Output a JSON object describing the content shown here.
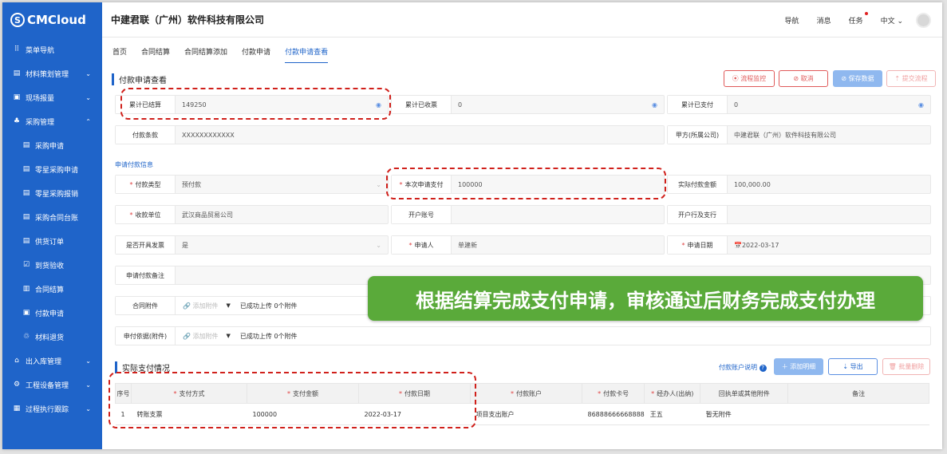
{
  "brand": {
    "logo_text": "CMCloud",
    "logo_mark": "S"
  },
  "sidebar": {
    "items": [
      {
        "label": "菜单导航",
        "icon": "grid-icon",
        "glyph": "⠿",
        "sub": false,
        "chevron": ""
      },
      {
        "label": "材料策划管理",
        "icon": "clipboard-icon",
        "glyph": "▤",
        "sub": false,
        "chevron": "⌄"
      },
      {
        "label": "现场报量",
        "icon": "report-icon",
        "glyph": "▣",
        "sub": false,
        "chevron": "⌄"
      },
      {
        "label": "采购管理",
        "icon": "org-icon",
        "glyph": "♣",
        "sub": false,
        "chevron": "⌃"
      },
      {
        "label": "采购申请",
        "icon": "form-icon",
        "glyph": "▤",
        "sub": true,
        "chevron": ""
      },
      {
        "label": "零星采购申请",
        "icon": "form-icon",
        "glyph": "▤",
        "sub": true,
        "chevron": ""
      },
      {
        "label": "零星采购报销",
        "icon": "form-icon",
        "glyph": "▤",
        "sub": true,
        "chevron": ""
      },
      {
        "label": "采购合同台账",
        "icon": "form-icon",
        "glyph": "▤",
        "sub": true,
        "chevron": ""
      },
      {
        "label": "供货订单",
        "icon": "list-icon",
        "glyph": "▤",
        "sub": true,
        "chevron": ""
      },
      {
        "label": "到货验收",
        "icon": "check-icon",
        "glyph": "☑",
        "sub": true,
        "chevron": ""
      },
      {
        "label": "合同结算",
        "icon": "doc-icon",
        "glyph": "▥",
        "sub": true,
        "chevron": ""
      },
      {
        "label": "付款申请",
        "icon": "pay-icon",
        "glyph": "▣",
        "sub": true,
        "chevron": ""
      },
      {
        "label": "材料退货",
        "icon": "return-icon",
        "glyph": "♲",
        "sub": true,
        "chevron": ""
      },
      {
        "label": "出入库管理",
        "icon": "warehouse-icon",
        "glyph": "⌂",
        "sub": false,
        "chevron": "⌄"
      },
      {
        "label": "工程设备管理",
        "icon": "gear-icon",
        "glyph": "⚙",
        "sub": false,
        "chevron": "⌄"
      },
      {
        "label": "过程执行跟踪",
        "icon": "track-icon",
        "glyph": "▦",
        "sub": false,
        "chevron": "⌄"
      }
    ]
  },
  "header": {
    "company": "中建君联（广州）软件科技有限公司",
    "links": [
      "导航",
      "消息",
      "任务",
      "中文 ⌄"
    ]
  },
  "tabs": [
    {
      "label": "首页",
      "active": false
    },
    {
      "label": "合同结算",
      "active": false
    },
    {
      "label": "合同结算添加",
      "active": false
    },
    {
      "label": "付款申请",
      "active": false
    },
    {
      "label": "付款申请查看",
      "active": true
    }
  ],
  "page": {
    "title": "付款申请查看",
    "buttons": {
      "monitor": "⦿ 流程监控",
      "cancel": "⊘ 取消",
      "save": "⊘ 保存数据",
      "submit": "⇡ 提交流程"
    }
  },
  "summary": {
    "settled_label": "累计已结算",
    "settled_value": "149250",
    "received_label": "累计已收票",
    "received_value": "0",
    "paid_label": "累计已支付",
    "paid_value": "0",
    "terms_label": "付款条款",
    "terms_value": "XXXXXXXXXXXX",
    "party_label": "甲方(所属公司)",
    "party_value": "中建君联（广州）软件科技有限公司"
  },
  "apply": {
    "section": "申请付款信息",
    "type_label": "付款类型",
    "type_value": "预付款",
    "amount_label": "本次申请支付",
    "amount_value": "100000",
    "actual_label": "实际付款金额",
    "actual_value": "100,000.00",
    "payee_label": "收款单位",
    "payee_value": "武汉商品贸易公司",
    "account_label": "开户账号",
    "account_value": "",
    "bank_label": "开户行及支行",
    "bank_value": "",
    "invoice_label": "是否开具发票",
    "invoice_value": "是",
    "applicant_label": "申请人",
    "applicant_value": "单建新",
    "date_label": "申请日期",
    "date_value": "📅2022-03-17",
    "remark_label": "申请付款备注",
    "contract_att_label": "合同附件",
    "contract_att_add": "🔗 添加附件",
    "contract_att_status": "已成功上传 0个附件",
    "basis_att_label": "申付依据(附件)",
    "basis_att_add": "🔗 添加附件",
    "basis_att_status": "已成功上传 0个附件"
  },
  "banner": "根据结算完成支付申请，审核通过后财务完成支付办理",
  "payment": {
    "title": "实际支付情况",
    "account_note": "付款账户说明",
    "add_btn": "＋ 添加明细",
    "export_btn": "⇣ 导出",
    "delete_btn": "🗑 批量删除",
    "columns": [
      "序号",
      "支付方式",
      "支付金额",
      "付款日期",
      "付款账户",
      "付款卡号",
      "经办人(出纳)",
      "回执单或其他附件",
      "备注"
    ],
    "rows": [
      [
        "1",
        "转账支票",
        "100000",
        "2022-03-17",
        "项目支出账户",
        "86888666668888",
        "王五",
        "暂无附件",
        ""
      ]
    ]
  },
  "colors": {
    "primary": "#1f64c9",
    "highlight": "#d0201b",
    "banner": "#5aaa3a"
  }
}
